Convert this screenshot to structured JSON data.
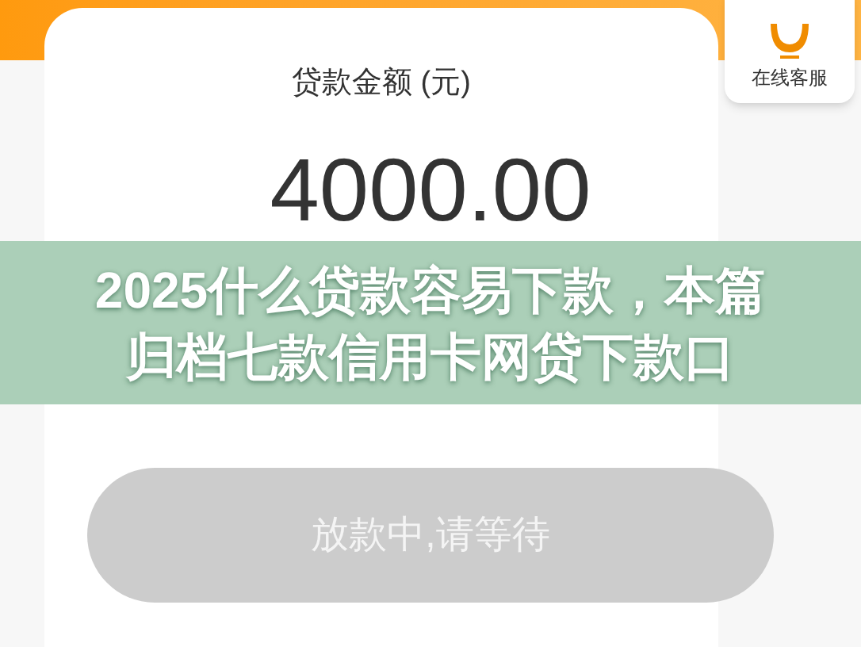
{
  "customer_service": {
    "label": "在线客服"
  },
  "loan_card": {
    "label": "贷款金额 (元)",
    "amount": "4000.00",
    "button": {
      "label": "放款中,请等待",
      "disabled": true
    }
  },
  "overlay_banner": {
    "title": "2025什么贷款容易下款，本篇归档七款信用卡网贷下款口"
  }
}
